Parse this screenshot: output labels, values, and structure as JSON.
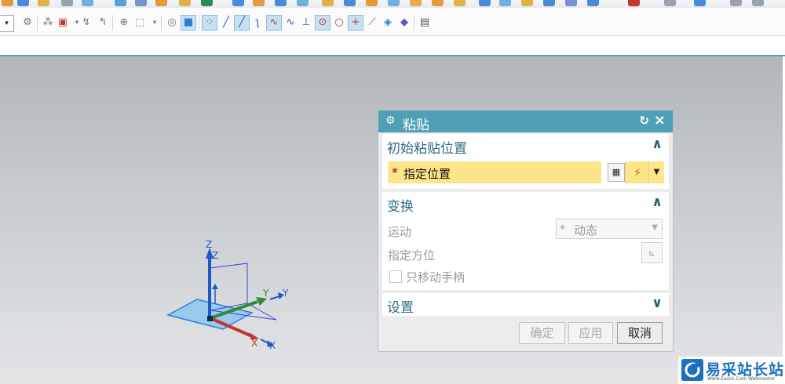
{
  "toolbar": {
    "combo_arrow": "▾",
    "icons": [
      "smart-select-icon",
      "selection-filter-icon",
      "snap-point-icon",
      "curve-rule-icon",
      "feature-group-icon",
      "show-hide-icon",
      "box-select-icon",
      "dropdown-arrow-icon",
      "part-icon",
      "solid-body-icon",
      "all-points-icon",
      "line-icon",
      "curve-icon",
      "bend-curve-icon",
      "spline-icon",
      "wave-curve-icon",
      "intersection-icon",
      "arc-center-icon",
      "quadrant-point-icon",
      "existing-point-icon",
      "point-on-curve-icon",
      "surface-point-icon",
      "bounded-grid-icon",
      "table-icon"
    ]
  },
  "dialog": {
    "title": "粘贴",
    "reset_icon": "reset-icon",
    "close_icon": "close-icon",
    "section_initial": {
      "label": "初始粘贴位置",
      "expanded": true,
      "specify_location": "指定位置",
      "required_marker": "*"
    },
    "section_transform": {
      "label": "变换",
      "expanded": true,
      "motion_label": "运动",
      "motion_value": "动态",
      "orientation_label": "指定方位",
      "move_handle_only_label": "只移动手柄",
      "move_handle_only_checked": false
    },
    "section_settings": {
      "label": "设置",
      "expanded": false
    },
    "buttons": {
      "ok": "确定",
      "apply": "应用",
      "cancel": "取消"
    }
  },
  "triad": {
    "axis_labels": {
      "z_outer": "Z",
      "z_inner": "Z",
      "y_inner": "Y",
      "y_outer": "Y",
      "x_inner": "X",
      "x_outer": "X"
    }
  },
  "watermark": {
    "name": "易采站长站",
    "sub": "Www.Easck.Com Webmaster"
  },
  "colors": {
    "titlebar": "#4f9fb5",
    "section_header": "#2e6d88",
    "required_field": "#fde68a",
    "axis_x": "#c0392b",
    "axis_y": "#2e8b3a",
    "axis_z": "#1f57c3"
  }
}
